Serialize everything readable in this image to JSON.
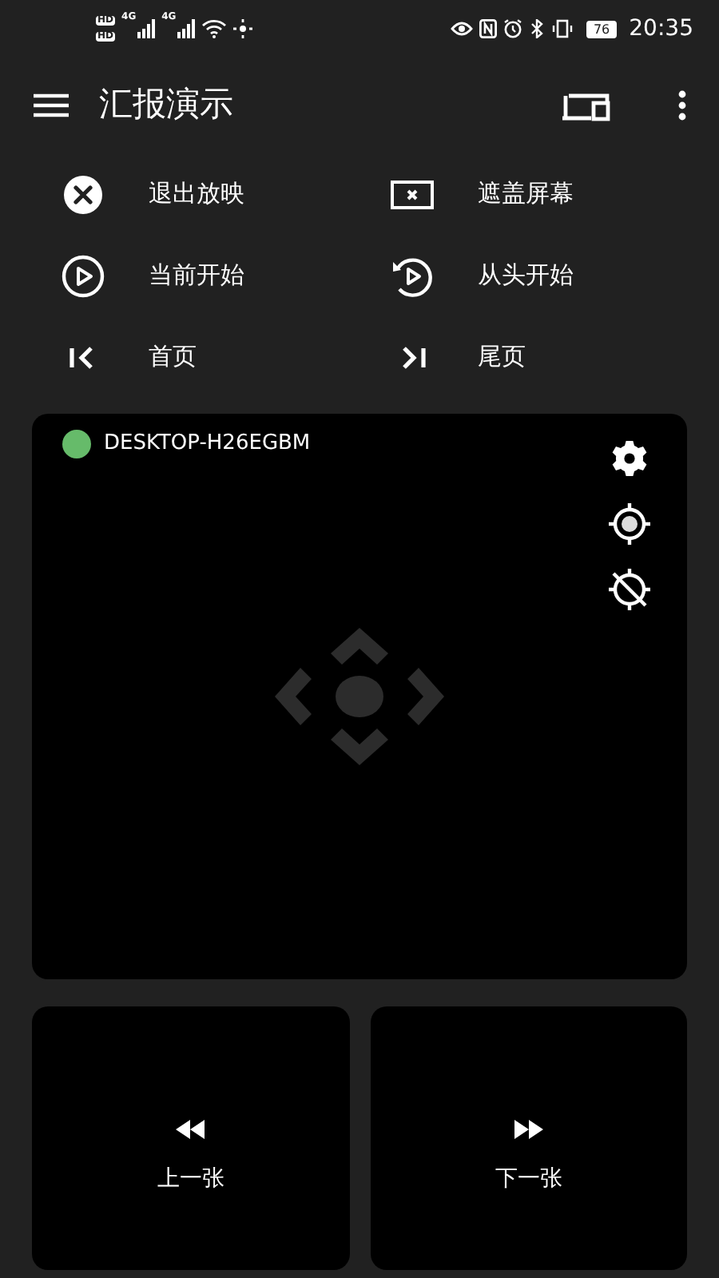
{
  "status_bar": {
    "sim_badges": [
      "HD",
      "HD"
    ],
    "signals": [
      {
        "network": "4G"
      },
      {
        "network": "4G"
      }
    ],
    "battery": "76",
    "time": "20:35"
  },
  "app_bar": {
    "title": "汇报演示"
  },
  "actions": [
    {
      "kind": "exit",
      "label": "退出放映"
    },
    {
      "kind": "blank",
      "label": "遮盖屏幕"
    },
    {
      "kind": "play",
      "label": "当前开始"
    },
    {
      "kind": "replay",
      "label": "从头开始"
    },
    {
      "kind": "first",
      "label": "首页"
    },
    {
      "kind": "last",
      "label": "尾页"
    }
  ],
  "device": {
    "name": "DESKTOP-H26EGBM",
    "color": "#66bb6a"
  },
  "nav_buttons": [
    {
      "kind": "prev",
      "label": "上一张"
    },
    {
      "kind": "next",
      "label": "下一张"
    }
  ]
}
